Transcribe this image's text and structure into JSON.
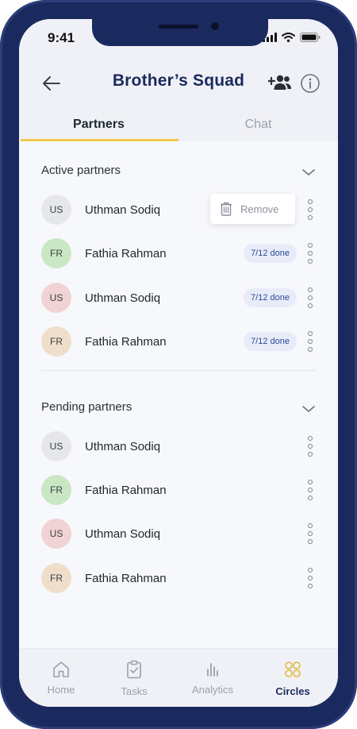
{
  "status": {
    "time": "9:41"
  },
  "header": {
    "title": "Brother’s Squad"
  },
  "tabs": [
    {
      "label": "Partners",
      "active": true
    },
    {
      "label": "Chat",
      "active": false
    }
  ],
  "active_section": {
    "title": "Active partners",
    "partners": [
      {
        "initials": "US",
        "name": "Uthman Sodiq",
        "avatar_color": "#e6e7ea",
        "progress": ""
      },
      {
        "initials": "FR",
        "name": "Fathia Rahman",
        "avatar_color": "#c9e7c3",
        "progress": "7/12 done"
      },
      {
        "initials": "US",
        "name": "Uthman Sodiq",
        "avatar_color": "#f1d3d3",
        "progress": "7/12 done"
      },
      {
        "initials": "FR",
        "name": "Fathia Rahman",
        "avatar_color": "#efdfca",
        "progress": "7/12 done"
      }
    ]
  },
  "context_menu": {
    "remove_label": "Remove"
  },
  "pending_section": {
    "title": "Pending partners",
    "partners": [
      {
        "initials": "US",
        "name": "Uthman Sodiq",
        "avatar_color": "#e6e7ea"
      },
      {
        "initials": "FR",
        "name": "Fathia Rahman",
        "avatar_color": "#c9e7c3"
      },
      {
        "initials": "US",
        "name": "Uthman Sodiq",
        "avatar_color": "#f1d3d3"
      },
      {
        "initials": "FR",
        "name": "Fathia Rahman",
        "avatar_color": "#efdfca"
      }
    ]
  },
  "bottom_nav": [
    {
      "label": "Home",
      "icon": "home-icon",
      "active": false
    },
    {
      "label": "Tasks",
      "icon": "clipboard-check-icon",
      "active": false
    },
    {
      "label": "Analytics",
      "icon": "bar-chart-icon",
      "active": false
    },
    {
      "label": "Circles",
      "icon": "circles-icon",
      "active": true
    }
  ],
  "colors": {
    "brand_navy": "#1b2a5e",
    "tab_indicator": "#f3c94c",
    "badge_bg": "#e8ecf8",
    "badge_text": "#2e4a9c",
    "active_nav_icon": "#e2b93b"
  }
}
